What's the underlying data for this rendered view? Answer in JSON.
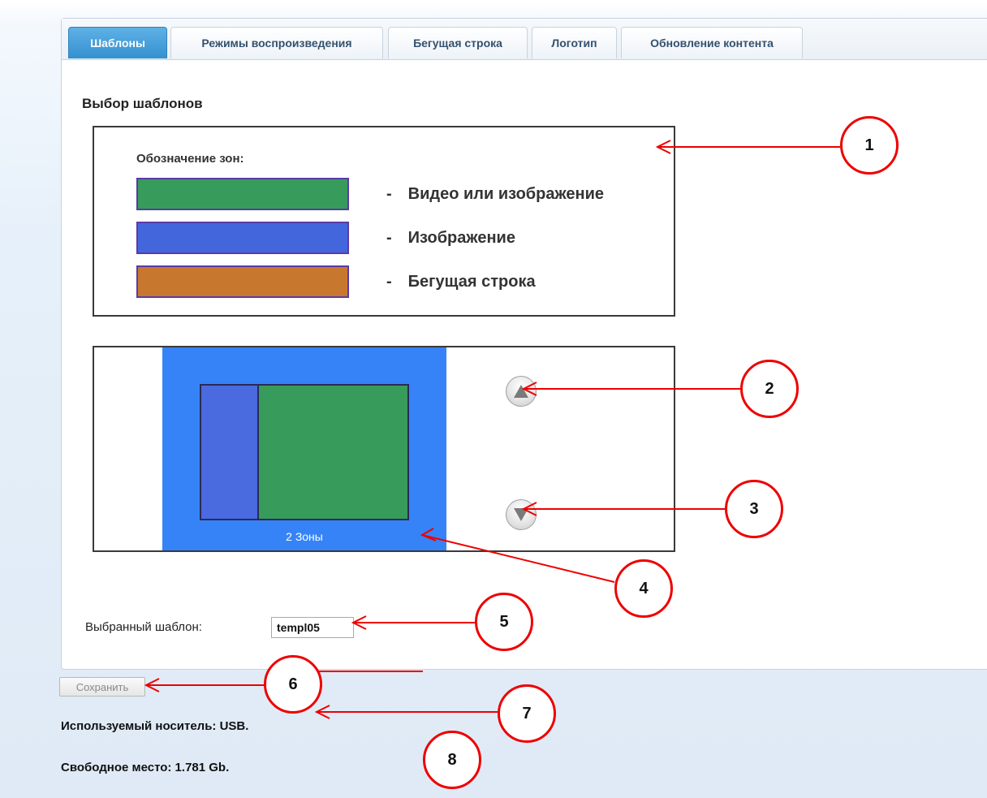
{
  "tabs": [
    {
      "label": "Шаблоны",
      "active": true
    },
    {
      "label": "Режимы воспроизведения",
      "active": false
    },
    {
      "label": "Бегущая строка",
      "active": false
    },
    {
      "label": "Логотип",
      "active": false
    },
    {
      "label": "Обновление контента",
      "active": false
    }
  ],
  "section_title": "Выбор шаблонов",
  "legend": {
    "title": "Обозначение зон:",
    "items": [
      {
        "color": "#379b5b",
        "dash": "-",
        "label": "Видео или изображение"
      },
      {
        "color": "#4466dd",
        "dash": "-",
        "label": "Изображение"
      },
      {
        "color": "#c8782e",
        "dash": "-",
        "label": "Бегущая строка"
      }
    ]
  },
  "template": {
    "caption": "2 Зоны",
    "preview_bg": "#3683f7",
    "up_icon": "triangle-up-icon",
    "down_icon": "triangle-down-icon"
  },
  "selected": {
    "label": "Выбранный шаблон:",
    "value": "templ05"
  },
  "save_label": "Сохранить",
  "status": {
    "media": "Используемый носитель: USB.",
    "free_space": "Свободное место: 1.781 Gb."
  },
  "callouts": [
    "1",
    "2",
    "3",
    "4",
    "5",
    "6",
    "7",
    "8"
  ],
  "colors": {
    "accent": "#3490cf",
    "callout_red": "#ee0000"
  }
}
